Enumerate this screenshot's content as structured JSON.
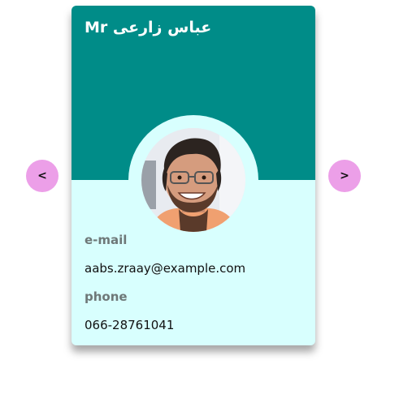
{
  "card": {
    "title": "Mr عباس زارعی",
    "avatar_alt": "profile photo",
    "email_label": "e-mail",
    "email_value": "aabs.zraay@example.com",
    "phone_label": "phone",
    "phone_value": "066-28761041"
  },
  "nav": {
    "prev_label": "<",
    "next_label": ">"
  },
  "colors": {
    "header": "#008c88",
    "card_body": "#d8fffe",
    "nav_button": "#ec9fe8",
    "label_text": "#6e7878"
  },
  "icons": {
    "prev": "chevron-left-icon",
    "next": "chevron-right-icon"
  }
}
